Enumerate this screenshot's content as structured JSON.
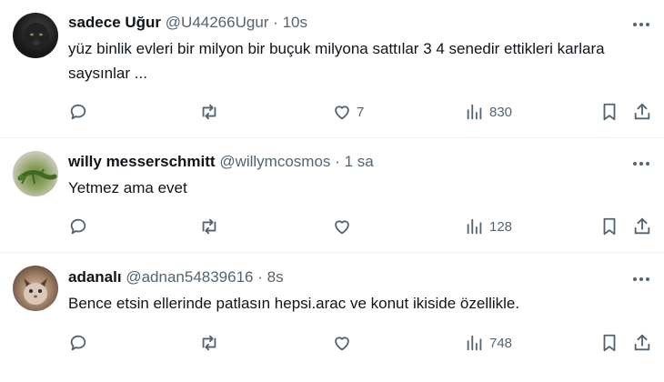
{
  "tweets": [
    {
      "name": "sadece Uğur",
      "handle": "@U44266Ugur",
      "separator": "·",
      "time": "10s",
      "text": "yüz binlik evleri bir milyon bir buçuk milyona sattılar 3 4 senedir ettikleri karlara saysınlar ...",
      "likes": "7",
      "views": "830"
    },
    {
      "name": "willy messerschmitt",
      "handle": "@willymcosmos",
      "separator": "·",
      "time": "1 sa",
      "text": "Yetmez ama evet",
      "likes": "",
      "views": "128"
    },
    {
      "name": "adanalı",
      "handle": "@adnan54839616",
      "separator": "·",
      "time": "8s",
      "text": "Bence etsin ellerinde patlasın hepsi.arac ve konut ikiside özellikle.",
      "likes": "",
      "views": "748"
    }
  ],
  "icons": {
    "reply": "reply-icon",
    "retweet": "retweet-icon",
    "like": "heart-icon",
    "views": "views-chart-icon",
    "bookmark": "bookmark-icon",
    "share": "share-icon",
    "more": "more-dots-icon"
  }
}
